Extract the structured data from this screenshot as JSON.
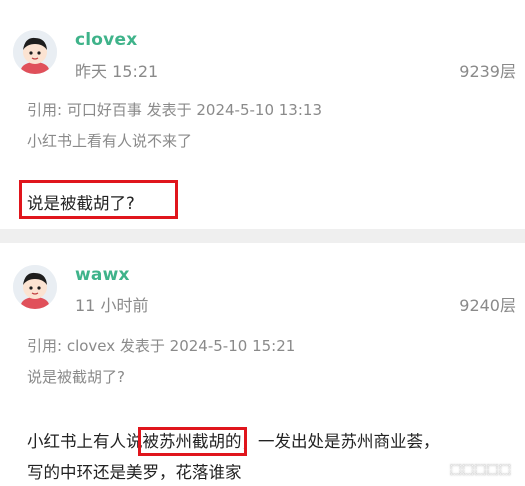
{
  "posts": [
    {
      "username": "clovex",
      "time": "昨天 15:21",
      "floor": "9239层",
      "quote_header": "引用: 可口好百事 发表于 2024-5-10 13:13",
      "quote_text": "小红书上看有人说不来了",
      "body": "说是被截胡了?"
    },
    {
      "username": "wawx",
      "time": "11 小时前",
      "floor": "9240层",
      "quote_header": "引用: clovex 发表于 2024-5-10 15:21",
      "quote_text": "说是被截胡了?",
      "body_line1_pre": "小红书上有人说",
      "body_line1_highlight": "被苏州截胡的",
      "body_line1_post": "，一发出处是苏州商业荟，",
      "body_line2": "写的中环还是美罗，花落谁家"
    }
  ],
  "colors": {
    "username": "#3fb38a",
    "meta": "#8a8a8a",
    "highlight_box": "#e0151c",
    "divider": "#efefef"
  },
  "icons": {
    "avatar": "cartoon-avatar-icon"
  }
}
